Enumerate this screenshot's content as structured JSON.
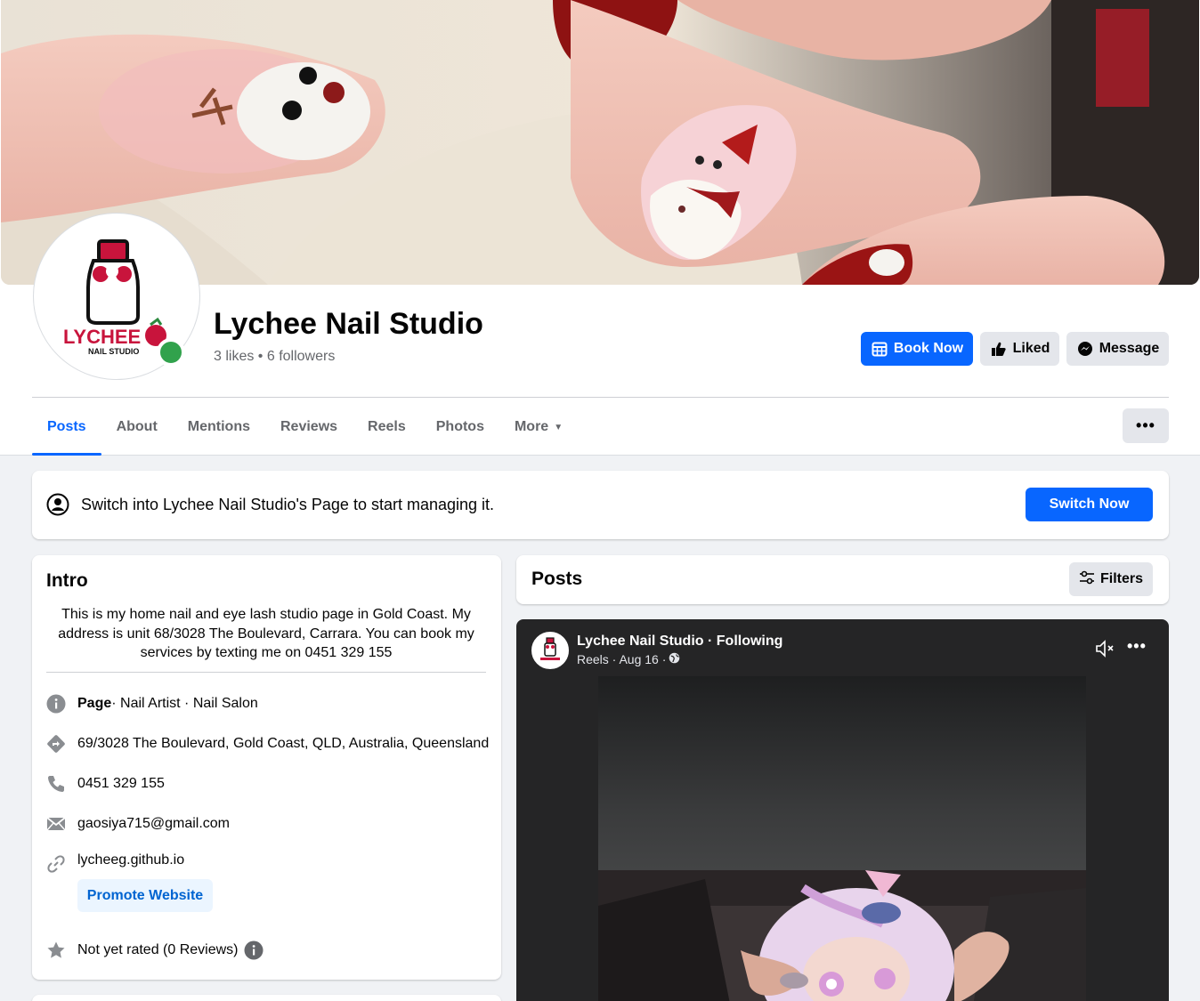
{
  "page": {
    "name": "Lychee Nail Studio",
    "stats": "3 likes • 6 followers"
  },
  "avatar_logo": {
    "brand": "LYCHEE",
    "sub": "NAIL STUDIO"
  },
  "actions": {
    "book_now": "Book Now",
    "liked": "Liked",
    "message": "Message"
  },
  "tabs": [
    {
      "label": "Posts",
      "active": true
    },
    {
      "label": "About"
    },
    {
      "label": "Mentions"
    },
    {
      "label": "Reviews"
    },
    {
      "label": "Reels"
    },
    {
      "label": "Photos"
    },
    {
      "label": "More"
    }
  ],
  "more_menu": "•••",
  "switch_banner": {
    "text": "Switch into Lychee Nail Studio's Page to start managing it.",
    "button": "Switch Now"
  },
  "intro": {
    "title": "Intro",
    "bio": "This is my home nail and eye lash studio page in Gold Coast. My address is unit 68/3028 The Boulevard, Carrara. You can book my services by texting me on 0451 329 155",
    "category_label": "Page",
    "category_rest": " · Nail Artist · Nail Salon",
    "address": "69/3028 The Boulevard, Gold Coast, QLD, Australia, Queensland",
    "phone": "0451 329 155",
    "email": "gaosiya715@gmail.com",
    "website": "lycheeg.github.io",
    "promote_button": "Promote Website",
    "rating": "Not yet rated (0 Reviews)"
  },
  "posts_section": {
    "title": "Posts",
    "filters": "Filters"
  },
  "reel_post": {
    "author": "Lychee Nail Studio · Following",
    "meta": "Reels · Aug 16 ·",
    "menu": "•••"
  },
  "colors": {
    "accent": "#0866ff",
    "online": "#31a24c",
    "brand_red": "#c8143c"
  },
  "icons": {
    "book": "calendar-icon",
    "liked": "thumbs-up-icon",
    "message": "messenger-icon",
    "info": "info-icon",
    "address": "directions-icon",
    "phone": "phone-icon",
    "email": "envelope-icon",
    "website": "link-icon",
    "rating": "star-icon",
    "filters": "sliders-icon",
    "mute": "speaker-muted-icon",
    "globe": "globe-icon"
  }
}
